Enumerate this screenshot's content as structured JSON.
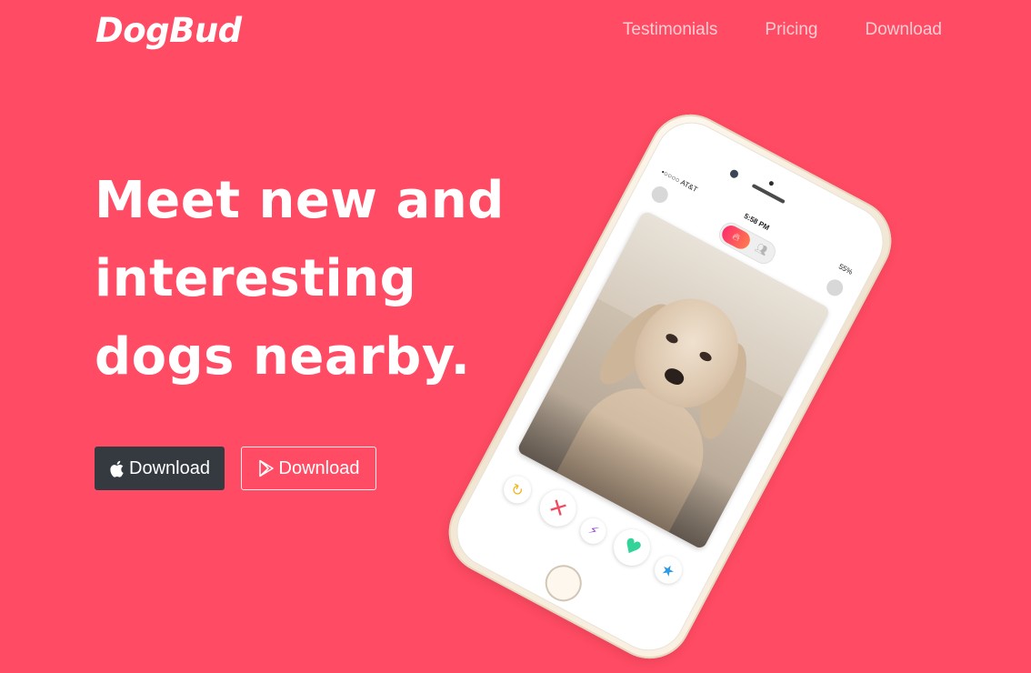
{
  "brand": "DogBud",
  "nav": {
    "items": [
      "Testimonials",
      "Pricing",
      "Download"
    ]
  },
  "hero": {
    "headline_lines": [
      "Meet new and",
      "interesting",
      "dogs nearby."
    ]
  },
  "buttons": {
    "apple": {
      "label": "Download",
      "icon": "apple-icon"
    },
    "play": {
      "label": "Download",
      "icon": "google-play-icon"
    }
  },
  "phone": {
    "status": {
      "carrier": "•○○○○ AT&T",
      "time": "5:58 PM",
      "battery": "55%"
    }
  },
  "colors": {
    "background": "#ff4b63",
    "apple_button": "#343a40",
    "text": "#ffffff"
  }
}
